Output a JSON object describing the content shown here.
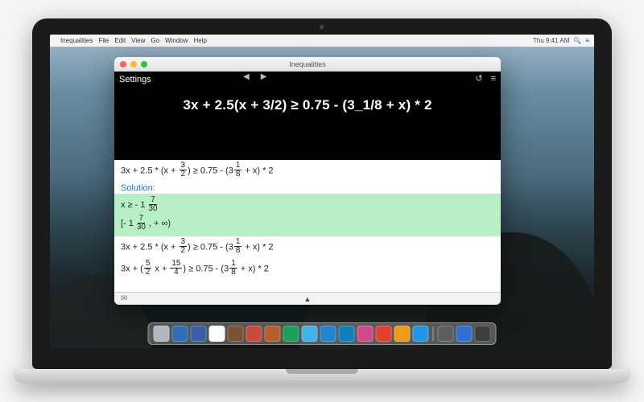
{
  "menubar": {
    "apple": "",
    "items": [
      "Inequalities",
      "File",
      "Edit",
      "View",
      "Go",
      "Window",
      "Help"
    ],
    "status": {
      "time": "Thu 9:41 AM",
      "search": "🔍",
      "user": "≡"
    }
  },
  "window": {
    "title": "Inequalities",
    "toolbar": {
      "settings": "Settings",
      "back": "◀",
      "forward": "▶",
      "undo": "↺",
      "menu": "≡"
    },
    "display_equation": "3x + 2.5(x + 3/2) ≥ 0.75 - (3_1/8 + x) * 2",
    "history": {
      "step_in": {
        "prefix": "3x + 2.5 * (x + ",
        "f1": {
          "num": "3",
          "den": "2"
        },
        "mid": ") ≥ 0.75 - (3",
        "f2": {
          "num": "1",
          "den": "8"
        },
        "suffix": " + x) * 2"
      },
      "solution_label": "Solution:",
      "solution_ineq": {
        "prefix": "x ≥ - 1",
        "frac": {
          "num": "7",
          "den": "30"
        }
      },
      "solution_interval": {
        "prefix": "[- 1",
        "frac": {
          "num": "7",
          "den": "30"
        },
        "suffix": ", + ∞)"
      },
      "repeat": {
        "prefix": "3x + 2.5 * (x + ",
        "f1": {
          "num": "3",
          "den": "2"
        },
        "mid": ") ≥ 0.75 - (3",
        "f2": {
          "num": "1",
          "den": "8"
        },
        "suffix": " + x) * 2"
      },
      "expand": {
        "p0": "3x + (",
        "f1": {
          "num": "5",
          "den": "2"
        },
        "p1": " x + ",
        "f2": {
          "num": "15",
          "den": "4"
        },
        "p2": ") ≥ 0.75 - (3",
        "f3": {
          "num": "1",
          "den": "8"
        },
        "p3": " + x) * 2"
      }
    },
    "footer": {
      "mail": "✉",
      "up": "▲"
    }
  },
  "dock_colors": [
    "#b0b7bd",
    "#2f6fb5",
    "#3a5ea8",
    "#ffffff",
    "#7a5230",
    "#c94a3b",
    "#b5602a",
    "#1aa05a",
    "#43b0e6",
    "#2184d0",
    "#0f7fba",
    "#d24a8a",
    "#e0412f",
    "#f09a1a",
    "#1e98e6",
    "#5e5e5e",
    "#2f6fd0",
    "#3e3e3e"
  ]
}
